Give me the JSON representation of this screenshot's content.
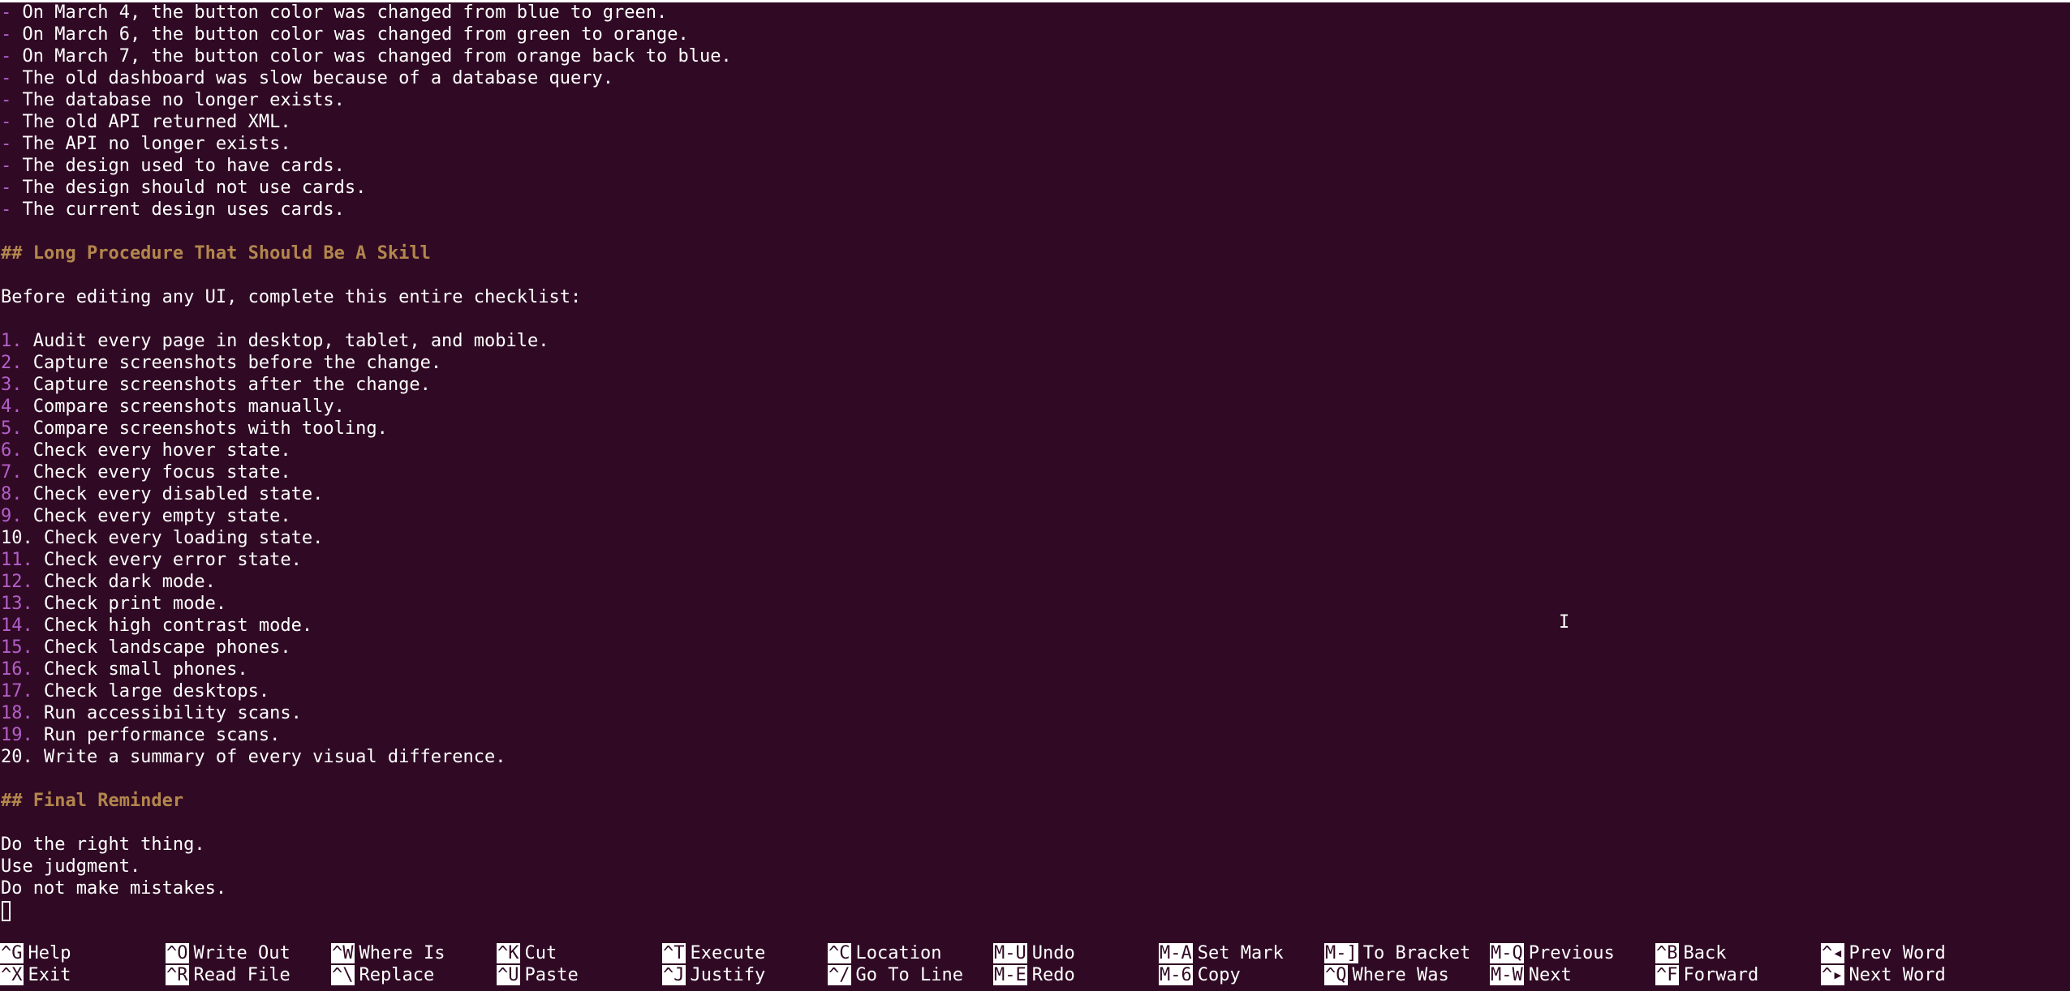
{
  "editor": {
    "lines": [
      {
        "type": "bullet",
        "text": "On March 4, the button color was changed from blue to green."
      },
      {
        "type": "bullet",
        "text": "On March 6, the button color was changed from green to orange."
      },
      {
        "type": "bullet",
        "text": "On March 7, the button color was changed from orange back to blue."
      },
      {
        "type": "bullet",
        "text": "The old dashboard was slow because of a database query."
      },
      {
        "type": "bullet",
        "text": "The database no longer exists."
      },
      {
        "type": "bullet",
        "text": "The old API returned XML."
      },
      {
        "type": "bullet",
        "text": "The API no longer exists."
      },
      {
        "type": "bullet",
        "text": "The design used to have cards."
      },
      {
        "type": "bullet",
        "text": "The design should not use cards."
      },
      {
        "type": "bullet",
        "text": "The current design uses cards."
      },
      {
        "type": "blank",
        "text": ""
      },
      {
        "type": "heading",
        "text": "## Long Procedure That Should Be A Skill"
      },
      {
        "type": "blank",
        "text": ""
      },
      {
        "type": "plain",
        "text": "Before editing any UI, complete this entire checklist:"
      },
      {
        "type": "blank",
        "text": ""
      },
      {
        "type": "numbered",
        "num": "1.",
        "text": " Audit every page in desktop, tablet, and mobile."
      },
      {
        "type": "numbered",
        "num": "2.",
        "text": " Capture screenshots before the change."
      },
      {
        "type": "numbered",
        "num": "3.",
        "text": " Capture screenshots after the change."
      },
      {
        "type": "numbered",
        "num": "4.",
        "text": " Compare screenshots manually."
      },
      {
        "type": "numbered",
        "num": "5.",
        "text": " Compare screenshots with tooling."
      },
      {
        "type": "numbered",
        "num": "6.",
        "text": " Check every hover state."
      },
      {
        "type": "numbered",
        "num": "7.",
        "text": " Check every focus state."
      },
      {
        "type": "numbered",
        "num": "8.",
        "text": " Check every disabled state."
      },
      {
        "type": "numbered",
        "num": "9.",
        "text": " Check every empty state."
      },
      {
        "type": "plain",
        "text": "10. Check every loading state."
      },
      {
        "type": "numbered",
        "num": "11.",
        "text": " Check every error state."
      },
      {
        "type": "numbered",
        "num": "12.",
        "text": " Check dark mode."
      },
      {
        "type": "numbered",
        "num": "13.",
        "text": " Check print mode."
      },
      {
        "type": "numbered",
        "num": "14.",
        "text": " Check high contrast mode."
      },
      {
        "type": "numbered",
        "num": "15.",
        "text": " Check landscape phones."
      },
      {
        "type": "numbered",
        "num": "16.",
        "text": " Check small phones."
      },
      {
        "type": "numbered",
        "num": "17.",
        "text": " Check large desktops."
      },
      {
        "type": "numbered",
        "num": "18.",
        "text": " Run accessibility scans."
      },
      {
        "type": "numbered",
        "num": "19.",
        "text": " Run performance scans."
      },
      {
        "type": "plain",
        "text": "20. Write a summary of every visual difference."
      },
      {
        "type": "blank",
        "text": ""
      },
      {
        "type": "heading",
        "text": "## Final Reminder"
      },
      {
        "type": "blank",
        "text": ""
      },
      {
        "type": "plain",
        "text": "Do the right thing."
      },
      {
        "type": "plain",
        "text": "Use judgment."
      },
      {
        "type": "plain",
        "text": "Do not make mistakes."
      },
      {
        "type": "cursor",
        "text": ""
      }
    ]
  },
  "shortcuts": [
    [
      {
        "key": "^G",
        "label": "Help"
      },
      {
        "key": "^X",
        "label": "Exit"
      }
    ],
    [
      {
        "key": "^O",
        "label": "Write Out"
      },
      {
        "key": "^R",
        "label": "Read File"
      }
    ],
    [
      {
        "key": "^W",
        "label": "Where Is"
      },
      {
        "key": "^\\",
        "label": "Replace"
      }
    ],
    [
      {
        "key": "^K",
        "label": "Cut"
      },
      {
        "key": "^U",
        "label": "Paste"
      }
    ],
    [
      {
        "key": "^T",
        "label": "Execute"
      },
      {
        "key": "^J",
        "label": "Justify"
      }
    ],
    [
      {
        "key": "^C",
        "label": "Location"
      },
      {
        "key": "^/",
        "label": "Go To Line"
      }
    ],
    [
      {
        "key": "M-U",
        "label": "Undo"
      },
      {
        "key": "M-E",
        "label": "Redo"
      }
    ],
    [
      {
        "key": "M-A",
        "label": "Set Mark"
      },
      {
        "key": "M-6",
        "label": "Copy"
      }
    ],
    [
      {
        "key": "M-]",
        "label": "To Bracket"
      },
      {
        "key": "^Q",
        "label": "Where Was"
      }
    ],
    [
      {
        "key": "M-Q",
        "label": "Previous"
      },
      {
        "key": "M-W",
        "label": "Next"
      }
    ],
    [
      {
        "key": "^B",
        "label": "Back"
      },
      {
        "key": "^F",
        "label": "Forward"
      }
    ],
    [
      {
        "key": "^◂",
        "label": "Prev Word"
      },
      {
        "key": "^▸",
        "label": "Next Word"
      }
    ]
  ],
  "colors": {
    "background": "#300a24",
    "text": "#ffffff",
    "bullet_marker": "#b35fc9",
    "heading": "#b3864d"
  },
  "icons": {
    "mouse_cursor": "i-beam-icon"
  }
}
